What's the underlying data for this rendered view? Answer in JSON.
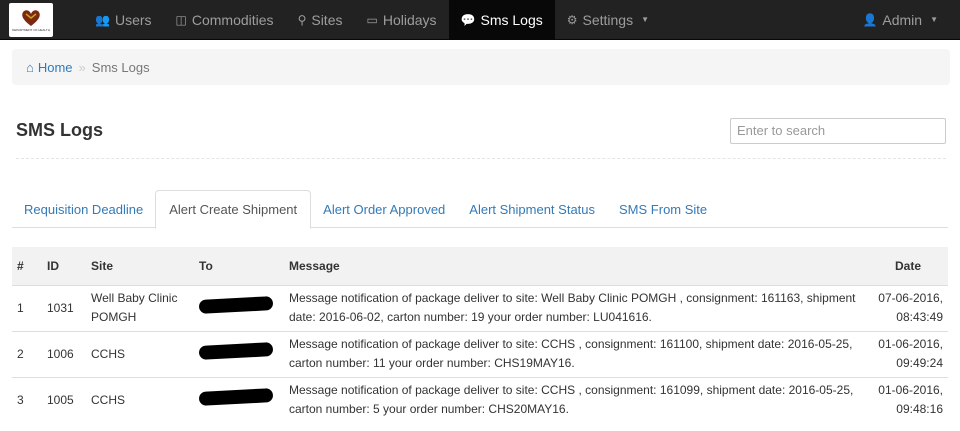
{
  "logo": {
    "text": "DEPARTMENT OF HEALTH"
  },
  "nav": {
    "items": [
      {
        "label": "Users",
        "icon": "users-icon",
        "glyph": "👥"
      },
      {
        "label": "Commodities",
        "icon": "commodities-icon",
        "glyph": "◫"
      },
      {
        "label": "Sites",
        "icon": "map-marker-icon",
        "glyph": "⚲"
      },
      {
        "label": "Holidays",
        "icon": "calendar-icon",
        "glyph": "▭"
      },
      {
        "label": "Sms Logs",
        "icon": "comment-icon",
        "glyph": "💬",
        "active": true
      },
      {
        "label": "Settings",
        "icon": "gear-icon",
        "glyph": "⚙",
        "dropdown": true
      }
    ],
    "user": {
      "label": "Admin",
      "icon": "user-icon",
      "glyph": "👤"
    }
  },
  "breadcrumb": {
    "home": "Home",
    "separator": "»",
    "current": "Sms Logs"
  },
  "page": {
    "title": "SMS Logs"
  },
  "search": {
    "placeholder": "Enter to search",
    "value": ""
  },
  "tabs": [
    {
      "label": "Requisition Deadline"
    },
    {
      "label": "Alert Create Shipment",
      "active": true
    },
    {
      "label": "Alert Order Approved"
    },
    {
      "label": "Alert Shipment Status"
    },
    {
      "label": "SMS From Site"
    }
  ],
  "table": {
    "headers": [
      "#",
      "ID",
      "Site",
      "To",
      "Message",
      "Date"
    ],
    "rows": [
      {
        "num": "1",
        "id": "1031",
        "site": "Well Baby Clinic POMGH",
        "to": "",
        "message": "Message notification of package deliver to site: Well Baby Clinic POMGH , consignment: 161163, shipment date: 2016-06-02, carton number: 19 your order number: LU041616.",
        "date": "07-06-2016,",
        "time": "08:43:49"
      },
      {
        "num": "2",
        "id": "1006",
        "site": "CCHS",
        "to": "",
        "message": "Message notification of package deliver to site: CCHS , consignment: 161100, shipment date: 2016-05-25, carton number: 11 your order number: CHS19MAY16.",
        "date": "01-06-2016,",
        "time": "09:49:24"
      },
      {
        "num": "3",
        "id": "1005",
        "site": "CCHS",
        "to": "",
        "message": "Message notification of package deliver to site: CCHS , consignment: 161099, shipment date: 2016-05-25, carton number: 5 your order number: CHS20MAY16.",
        "date": "01-06-2016,",
        "time": "09:48:16"
      }
    ]
  },
  "colors": {
    "navbar": "#222222",
    "link": "#337ab7",
    "active_nav": "#080808"
  }
}
